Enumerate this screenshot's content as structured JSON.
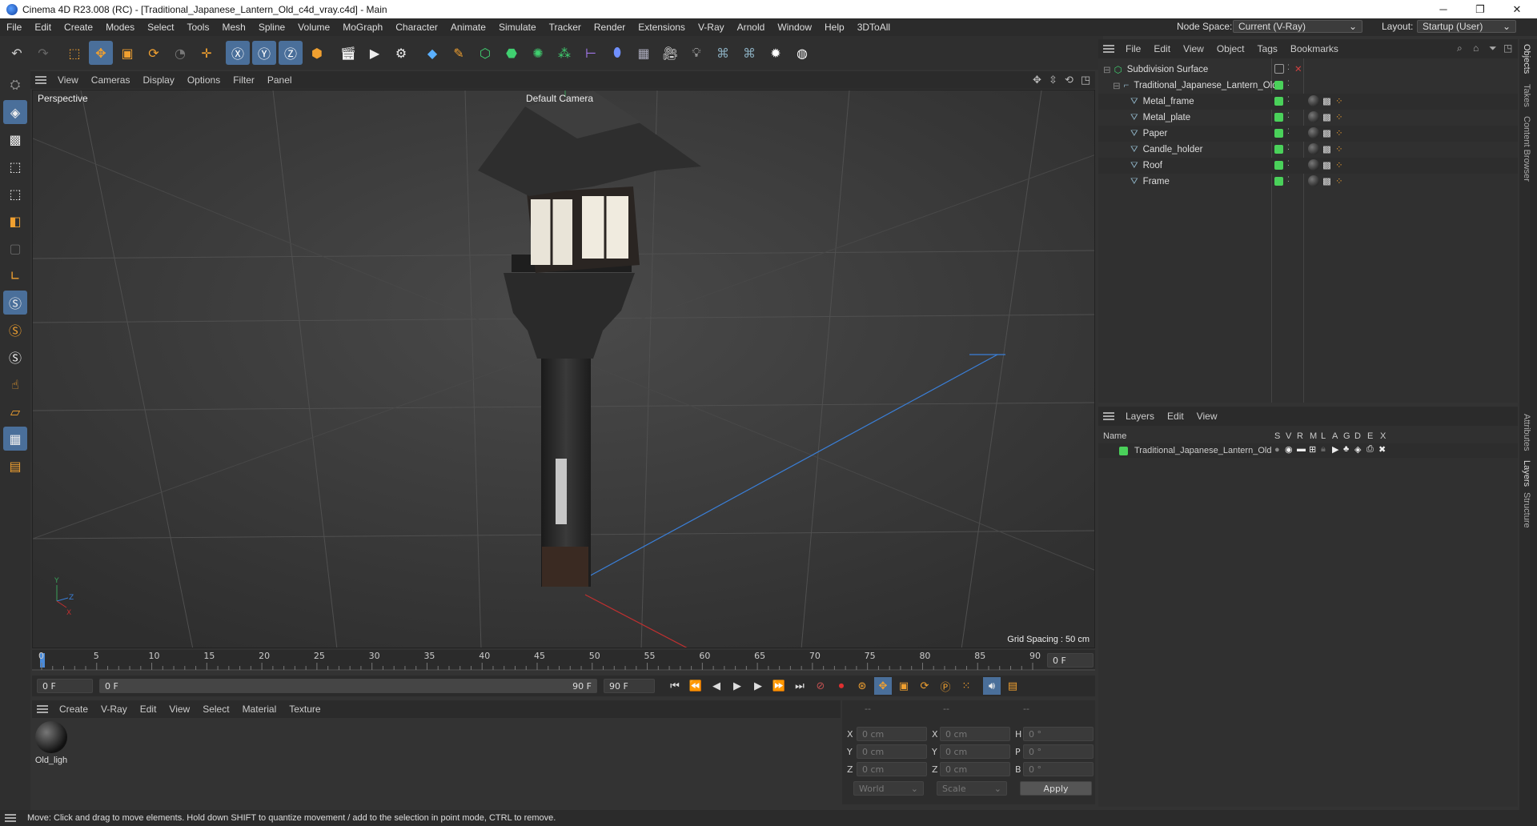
{
  "window": {
    "title": "Cinema 4D R23.008 (RC) - [Traditional_Japanese_Lantern_Old_c4d_vray.c4d] - Main"
  },
  "menubar": {
    "items": [
      "File",
      "Edit",
      "Create",
      "Modes",
      "Select",
      "Tools",
      "Mesh",
      "Spline",
      "Volume",
      "MoGraph",
      "Character",
      "Animate",
      "Simulate",
      "Tracker",
      "Render",
      "Extensions",
      "V-Ray",
      "Arnold",
      "Window",
      "Help",
      "3DToAll"
    ],
    "node_space_label": "Node Space:",
    "node_space_value": "Current (V-Ray)",
    "layout_label": "Layout:",
    "layout_value": "Startup (User)"
  },
  "viewport": {
    "menu": [
      "View",
      "Cameras",
      "Display",
      "Options",
      "Filter",
      "Panel"
    ],
    "label": "Perspective",
    "camera": "Default Camera",
    "grid_spacing": "Grid Spacing : 50 cm"
  },
  "timeline": {
    "ticks": [
      "0",
      "5",
      "10",
      "15",
      "20",
      "25",
      "30",
      "35",
      "40",
      "45",
      "50",
      "55",
      "60",
      "65",
      "70",
      "75",
      "80",
      "85",
      "90"
    ],
    "current_frame": "0 F",
    "start_field": "0 F",
    "range_start": "0 F",
    "range_end": "90 F",
    "end_field": "90 F"
  },
  "materials": {
    "menu": [
      "Create",
      "V-Ray",
      "Edit",
      "View",
      "Select",
      "Material",
      "Texture"
    ],
    "items": [
      {
        "name": "Old_ligh"
      }
    ]
  },
  "coords": {
    "headers": [
      "--",
      "--",
      "--"
    ],
    "rows": [
      {
        "a": "X",
        "av": "0 cm",
        "b": "X",
        "bv": "0 cm",
        "c": "H",
        "cv": "0 °"
      },
      {
        "a": "Y",
        "av": "0 cm",
        "b": "Y",
        "bv": "0 cm",
        "c": "P",
        "cv": "0 °"
      },
      {
        "a": "Z",
        "av": "0 cm",
        "b": "Z",
        "bv": "0 cm",
        "c": "B",
        "cv": "0 °"
      }
    ],
    "world": "World",
    "scale": "Scale",
    "apply": "Apply"
  },
  "objects": {
    "menu": [
      "File",
      "Edit",
      "View",
      "Object",
      "Tags",
      "Bookmarks"
    ],
    "items": [
      {
        "name": "Subdivision Surface"
      },
      {
        "name": "Traditional_Japanese_Lantern_Old"
      },
      {
        "name": "Metal_frame"
      },
      {
        "name": "Metal_plate"
      },
      {
        "name": "Paper"
      },
      {
        "name": "Candle_holder"
      },
      {
        "name": "Roof"
      },
      {
        "name": "Frame"
      }
    ]
  },
  "layers": {
    "menu": [
      "Layers",
      "Edit",
      "View"
    ],
    "name_header": "Name",
    "cols": [
      "S",
      "V",
      "R",
      "M",
      "L",
      "A",
      "G",
      "D",
      "E",
      "X"
    ],
    "items": [
      {
        "name": "Traditional_Japanese_Lantern_Old"
      }
    ]
  },
  "right_tabs": [
    "Objects",
    "Takes",
    "Content Browser",
    "Attributes",
    "Layers",
    "Structure"
  ],
  "status": "Move: Click and drag to move elements. Hold down SHIFT to quantize movement / add to the selection in point mode, CTRL to remove.",
  "colors": {
    "accent": "#4a6f9a",
    "layer_green": "#4ad15a",
    "axis_blue": "#3a7fd8",
    "axis_red": "#c03030"
  }
}
